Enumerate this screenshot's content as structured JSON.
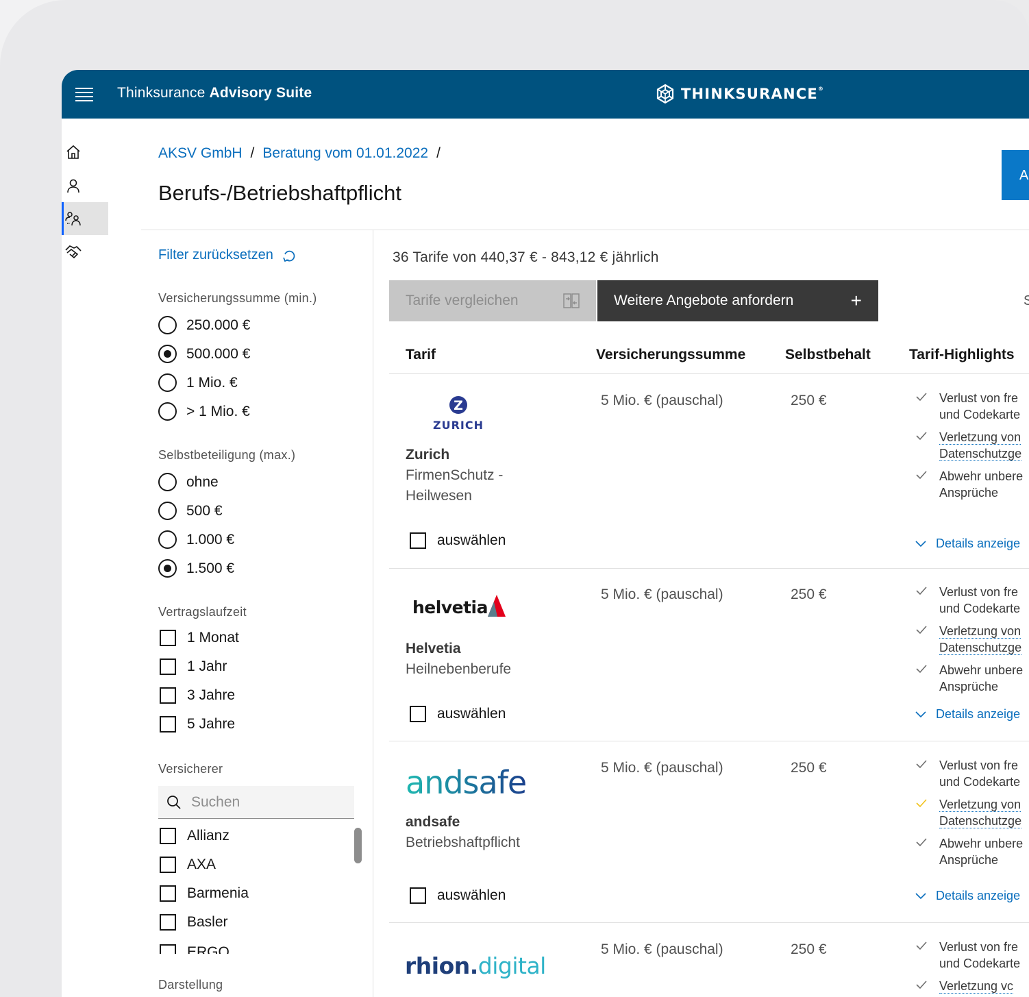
{
  "header": {
    "app_title_prefix": "Thinksurance",
    "app_title_bold": "Advisory Suite",
    "brand": "THINKSURANCE"
  },
  "breadcrumb": [
    "AKSV GmbH",
    "Beratung vom 01.01.2022"
  ],
  "breadcrumb_sep": "/",
  "page_title": "Berufs-/Betriebshaftpflicht",
  "top_action_label": "A",
  "filters": {
    "reset": "Filter zurücksetzen",
    "sum_label": "Versicherungssumme (min.)",
    "sum_options": [
      "250.000 €",
      "500.000 €",
      "1 Mio. €",
      "> 1 Mio. €"
    ],
    "sum_selected": 1,
    "deductible_label": "Selbstbeteiligung (max.)",
    "deductible_options": [
      "ohne",
      "500 €",
      "1.000 €",
      "1.500 €"
    ],
    "deductible_selected": 3,
    "term_label": "Vertragslaufzeit",
    "term_options": [
      "1 Monat",
      "1 Jahr",
      "3 Jahre",
      "5 Jahre"
    ],
    "insurer_label": "Versicherer",
    "search_placeholder": "Suchen",
    "insurers": [
      "Allianz",
      "AXA",
      "Barmenia",
      "Basler",
      "ERGO"
    ],
    "display_label": "Darstellung"
  },
  "results": {
    "summary": "36 Tarife von 440,37 € - 843,12 € jährlich",
    "compare_button": "Tarife vergleichen",
    "more_button": "Weitere Angebote anfordern",
    "more_icon": "+",
    "edge_glyph": "S",
    "columns": [
      "Tarif",
      "Versicherungssumme",
      "Selbstbehalt",
      "Tarif-Highlights"
    ],
    "select_label": "auswählen",
    "details_label": "Details anzeige",
    "highlights": [
      [
        "Verlust von fre",
        "und Codekarte"
      ],
      [
        "Verletzung von",
        "Datenschutzge"
      ],
      [
        "Abwehr unbere",
        "Ansprüche"
      ]
    ],
    "rows": [
      {
        "insurer": "Zurich",
        "product": [
          "FirmenSchutz -",
          "Heilwesen"
        ],
        "sum": "5 Mio. € (pauschal)",
        "deductible": "250 €",
        "logo_text": "ZURICH",
        "logo_mark": "Z"
      },
      {
        "insurer": "Helvetia",
        "product": [
          "Heilnebenberufe"
        ],
        "sum": "5 Mio. € (pauschal)",
        "deductible": "250 €",
        "logo_text": "helvetia"
      },
      {
        "insurer": "andsafe",
        "product": [
          "Betriebshaftpflicht"
        ],
        "sum": "5 Mio. € (pauschal)",
        "deductible": "250 €",
        "logo_text": "andsafe"
      },
      {
        "insurer": "rhion.digital",
        "product": [],
        "sum": "5 Mio. € (pauschal)",
        "deductible": "250 €",
        "logo_text_a": "rhion.",
        "logo_text_b": "digital",
        "highlight_partial": "Verletzung vc"
      }
    ]
  },
  "colors": {
    "header_bg": "#00527f",
    "link": "#0a6ebd",
    "accent_button": "#0a78c8",
    "check_ok": "#6f6f6f",
    "check_warn": "#f1c21b"
  }
}
